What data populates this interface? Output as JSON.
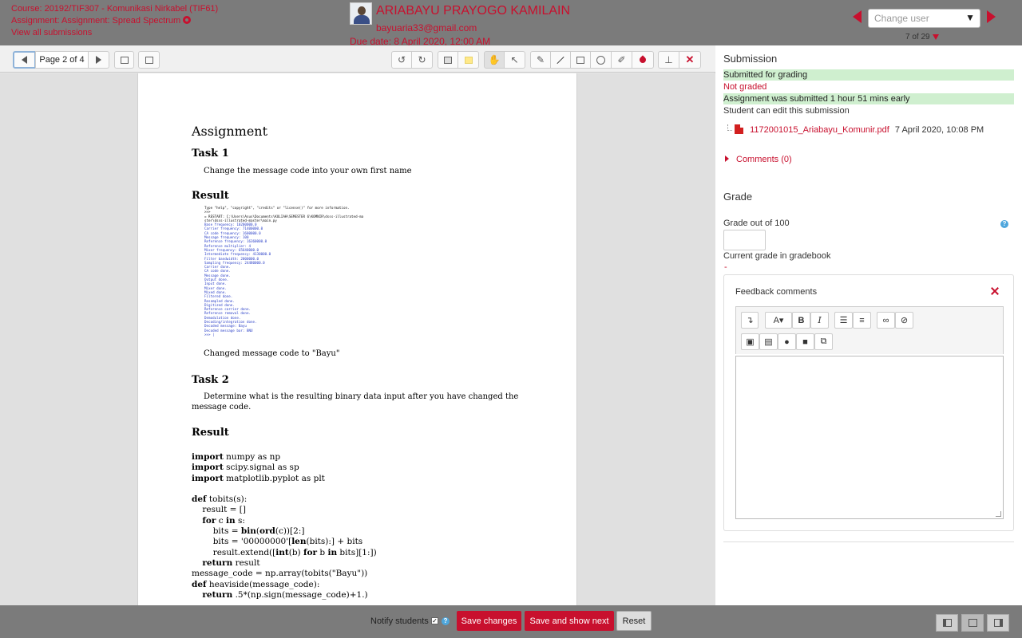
{
  "header": {
    "course": "Course: 20192/TIF307 - Komunikasi Nirkabel (TIF61)",
    "assignment": "Assignment: Assignment: Spread Spectrum",
    "view_all": "View all submissions",
    "student_name": "ARIABAYU PRAYOGO KAMILAIN",
    "student_email": "bayuaria33@gmail.com",
    "due_date": "Due date: 8 April 2020, 12:00 AM",
    "change_user_placeholder": "Change user",
    "user_count": "7 of 29"
  },
  "toolbar": {
    "page_label": "Page 2 of 4"
  },
  "pdf": {
    "title": "Assignment",
    "task1_heading": "Task 1",
    "task1_text": "Change the message code into your own first name",
    "result1_heading": "Result",
    "console_lines": [
      "Type \"help\", \"copyright\", \"credits\" or \"license()\" for more information.",
      ">>> ",
      "= RESTART: C:\\Users\\Asus\\Documents\\KULIAH\\SEMESTER 6\\KOMNIR\\dsss-illustrated-ma",
      "ster\\dsss-illustrated-master\\main.py",
      "Base frequency:  10200000.0",
      "Carrier frequency:  71400000.0",
      "CA code frequency:  1600000.0",
      "Message frequency:  100",
      "Reference frequency:  16360000.0",
      "Reference multiplier:  4",
      "Mixer frequency:  65640000.0",
      "Intermediate frequency:  4130000.0",
      "Filter bandwidth:  2000000.0",
      "Sampling frequency:  24480000.0",
      "Carrier done.",
      "CA code done.",
      "Message done.",
      "Output done.",
      "Input done.",
      "Mixer done.",
      "Mixed done.",
      "Filtered done.",
      "Resampled done.",
      "Digitized done.",
      "Reference carrier done.",
      "Reference removal done.",
      "Demodulation done.",
      "Decoding/integration done.",
      "Decoded message: Bayu",
      "Decoded message bar: BNU",
      ">>> |"
    ],
    "changed_text": "Changed message code to \"Bayu\"",
    "task2_heading": "Task 2",
    "task2_text": "Determine what is the resulting binary data input after you have changed the message code.",
    "result2_heading": "Result",
    "code": "<b>import</b> numpy as np\n<b>import</b> scipy.signal as sp\n<b>import</b> matplotlib.pyplot as plt\n\n<b>def</b> tobits(s):\n    result = []\n    <b>for</b> c <b>in</b> s:\n        bits = <b>bin</b>(<b>ord</b>(c))[2:]\n        bits = '00000000'[<b>len</b>(bits):] + bits\n        result.extend([<b>int</b>(b) <b>for</b> b <b>in</b> bits][1:])\n    <b>return</b> result\nmessage_code = np.array(tobits(\"Bayu\"))\n<b>def</b> heaviside(message_code):\n    <b>return</b> .5*(np.sign(message_code)+1.)"
  },
  "submission": {
    "title": "Submission",
    "status_submitted": "Submitted for grading",
    "status_grading": "Not graded",
    "status_time": "Assignment was submitted 1 hour 51 mins early",
    "status_edit": "Student can edit this submission",
    "file_name": "1172001015_Ariabayu_Komunir.pdf",
    "file_date": "7 April 2020, 10:08 PM",
    "comments": "Comments (0)"
  },
  "grade": {
    "title": "Grade",
    "grade_out_of": "Grade out of 100",
    "grade_value": "",
    "current_grade_label": "Current grade in gradebook",
    "current_grade_value": "-",
    "feedback_label": "Feedback comments"
  },
  "bottom": {
    "notify_label": "Notify students",
    "save": "Save changes",
    "save_next": "Save and show next",
    "reset": "Reset"
  },
  "colors": {
    "accent": "#c8102e",
    "bar_gray": "#7b7b7b",
    "status_green": "#cfefcf"
  }
}
